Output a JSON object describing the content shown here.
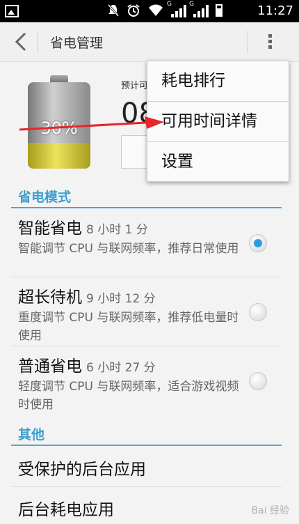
{
  "status_bar": {
    "time": "11:27",
    "signal_1_label": "G",
    "signal_2_label": "G",
    "icons": [
      "image-icon",
      "mute-icon",
      "alarm-icon",
      "wifi-icon",
      "signal-icon",
      "signal-icon",
      "battery-icon"
    ]
  },
  "action_bar": {
    "title": "省电管理",
    "back_icon": "chevron-left-icon",
    "overflow_icon": "overflow-menu-icon"
  },
  "battery": {
    "percent_text": "30%",
    "level": 0.3
  },
  "estimate": {
    "label": "预计可",
    "value": "08"
  },
  "overflow_menu": {
    "items": [
      "耗电排行",
      "可用时间详情",
      "设置"
    ]
  },
  "power_modes": {
    "header": "省电模式",
    "items": [
      {
        "name": "智能省电",
        "time": "8 小时 1 分",
        "desc": "智能调节 CPU 与联网频率，推荐日常使用",
        "selected": true
      },
      {
        "name": "超长待机",
        "time": "9 小时 12 分",
        "desc": "重度调节 CPU 与联网频率，推荐低电量时使用",
        "selected": false
      },
      {
        "name": "普通省电",
        "time": "6 小时 27 分",
        "desc": "轻度调节 CPU 与联网频率，适合游戏视频时使用",
        "selected": false
      }
    ]
  },
  "other": {
    "header": "其他",
    "items": [
      "受保护的后台应用",
      "后台耗电应用"
    ]
  },
  "watermark": "Bai 经验",
  "colors": {
    "accent": "#3aa0cf",
    "annotation_arrow": "#e8262a",
    "radio_selected": "#2d9be0"
  }
}
